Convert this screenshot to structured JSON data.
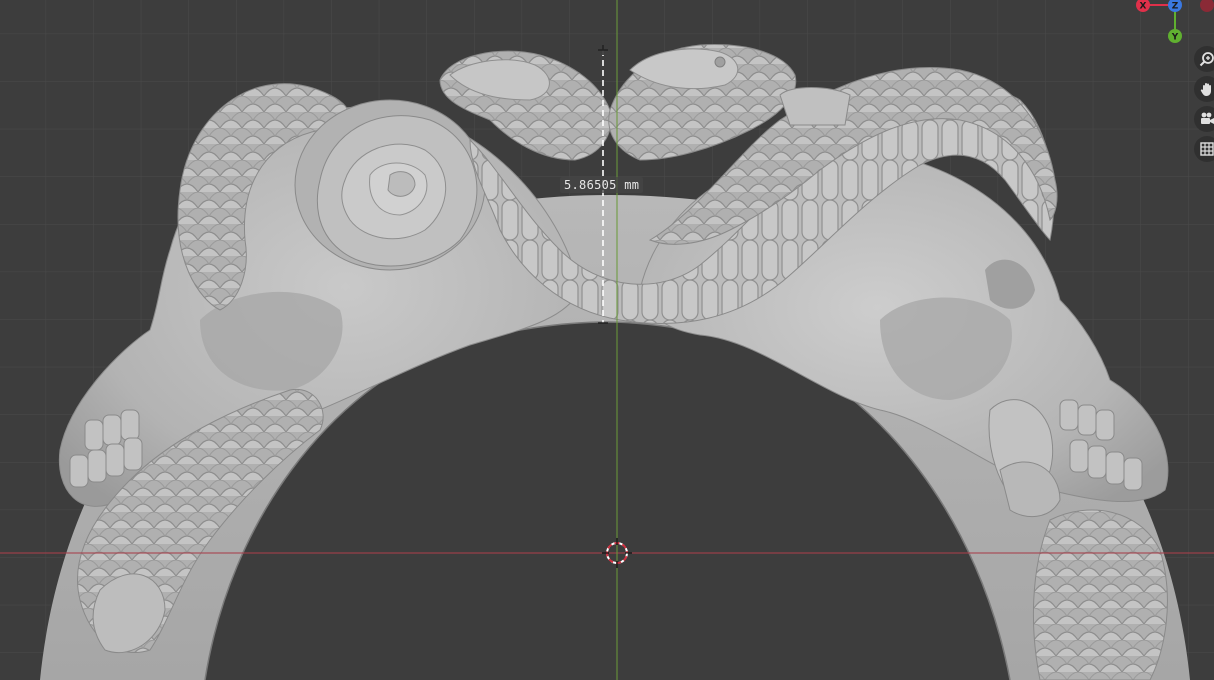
{
  "viewport": {
    "measurement": "5.86505 mm",
    "colors": {
      "background": "#3d3d3d",
      "grid": "#4a4a4a",
      "x_axis": "#a8404c",
      "y_axis": "#6a9a3a",
      "model": "#bdbdbd",
      "gizmo_x": "#e0304a",
      "gizmo_y": "#60b030",
      "gizmo_z": "#3a78e0"
    }
  },
  "gizmo": {
    "x_label": "X",
    "y_label": "Y",
    "z_label": "Z"
  },
  "nav_tools": [
    {
      "name": "zoom-icon"
    },
    {
      "name": "pan-hand-icon"
    },
    {
      "name": "camera-icon"
    },
    {
      "name": "grid-ortho-icon"
    }
  ]
}
